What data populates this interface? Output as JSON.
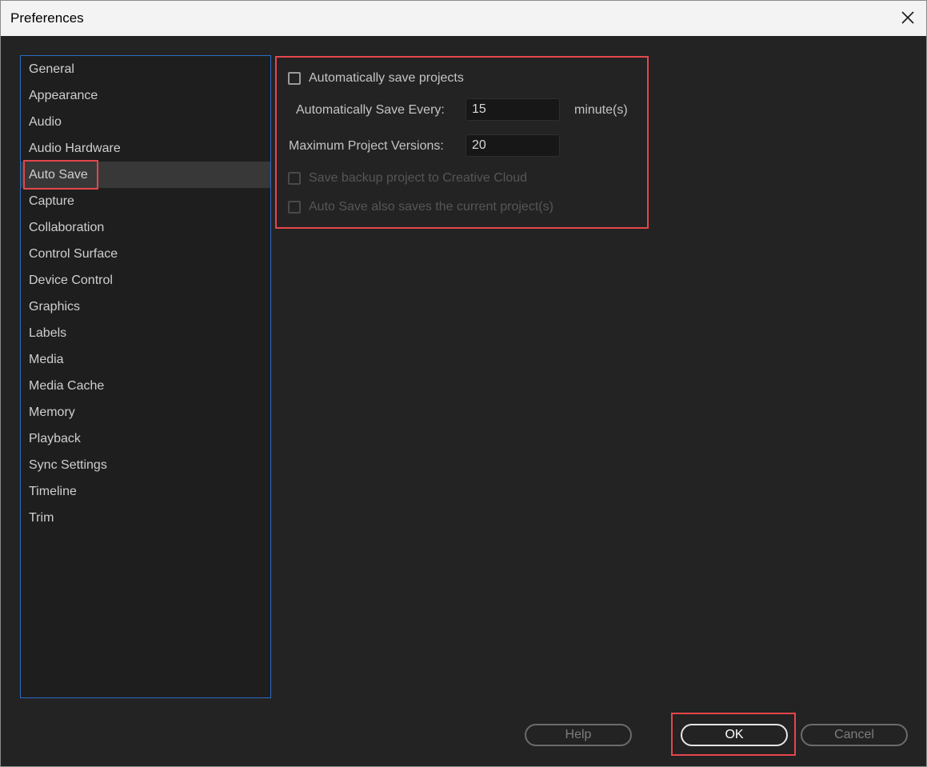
{
  "window": {
    "title": "Preferences"
  },
  "sidebar": {
    "items": [
      {
        "label": "General"
      },
      {
        "label": "Appearance"
      },
      {
        "label": "Audio"
      },
      {
        "label": "Audio Hardware"
      },
      {
        "label": "Auto Save",
        "selected": true
      },
      {
        "label": "Capture"
      },
      {
        "label": "Collaboration"
      },
      {
        "label": "Control Surface"
      },
      {
        "label": "Device Control"
      },
      {
        "label": "Graphics"
      },
      {
        "label": "Labels"
      },
      {
        "label": "Media"
      },
      {
        "label": "Media Cache"
      },
      {
        "label": "Memory"
      },
      {
        "label": "Playback"
      },
      {
        "label": "Sync Settings"
      },
      {
        "label": "Timeline"
      },
      {
        "label": "Trim"
      }
    ]
  },
  "autosave": {
    "auto_save_label": "Automatically save projects",
    "auto_save_checked": false,
    "save_every_label": "Automatically Save Every:",
    "save_every_value": "15",
    "save_every_unit": "minute(s)",
    "max_versions_label": "Maximum Project Versions:",
    "max_versions_value": "20",
    "backup_cc_label": "Save backup project to Creative Cloud",
    "backup_cc_checked": false,
    "current_project_label": "Auto Save also saves the current project(s)",
    "current_project_checked": false
  },
  "buttons": {
    "help": "Help",
    "ok": "OK",
    "cancel": "Cancel"
  },
  "colors": {
    "highlight": "#e5464b",
    "sidebar_border": "#2d6bc4",
    "background": "#232323"
  },
  "icons": {
    "close": "close-icon"
  }
}
